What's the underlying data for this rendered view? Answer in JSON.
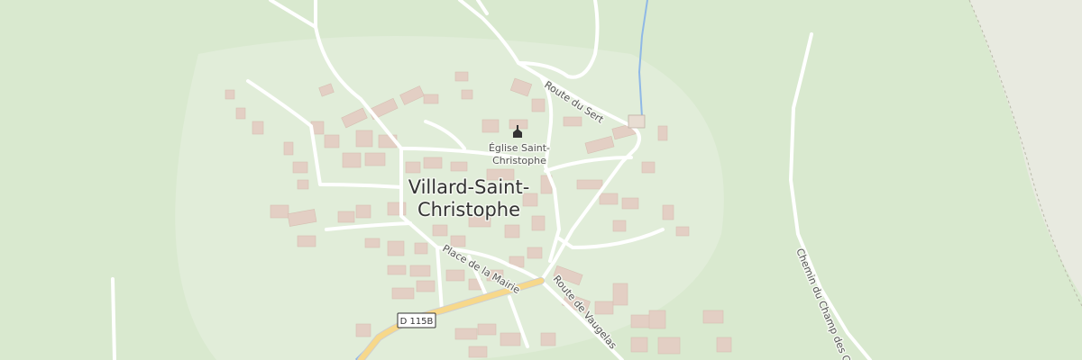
{
  "map": {
    "place_label_line1": "Villard-Saint-",
    "place_label_line2": "Christophe",
    "poi_label_line1": "Église Saint-",
    "poi_label_line2": "Christophe",
    "poi_icon": "church-icon",
    "streets": {
      "route_du_sert": "Route du Sert",
      "place_de_la_mairie": "Place de la Mairie",
      "route_de_vaugelas": "Route de Vaugelas",
      "chemin_du_champ": "Chemin du Champ des Ch"
    },
    "road_shield": "D 115B",
    "colors": {
      "land": "#dcebd2",
      "forest": "#cfe3c2",
      "road": "#ffffff",
      "main_road": "#f7d88a",
      "water": "#8fb8e6",
      "building": "#e3cfc4"
    }
  }
}
